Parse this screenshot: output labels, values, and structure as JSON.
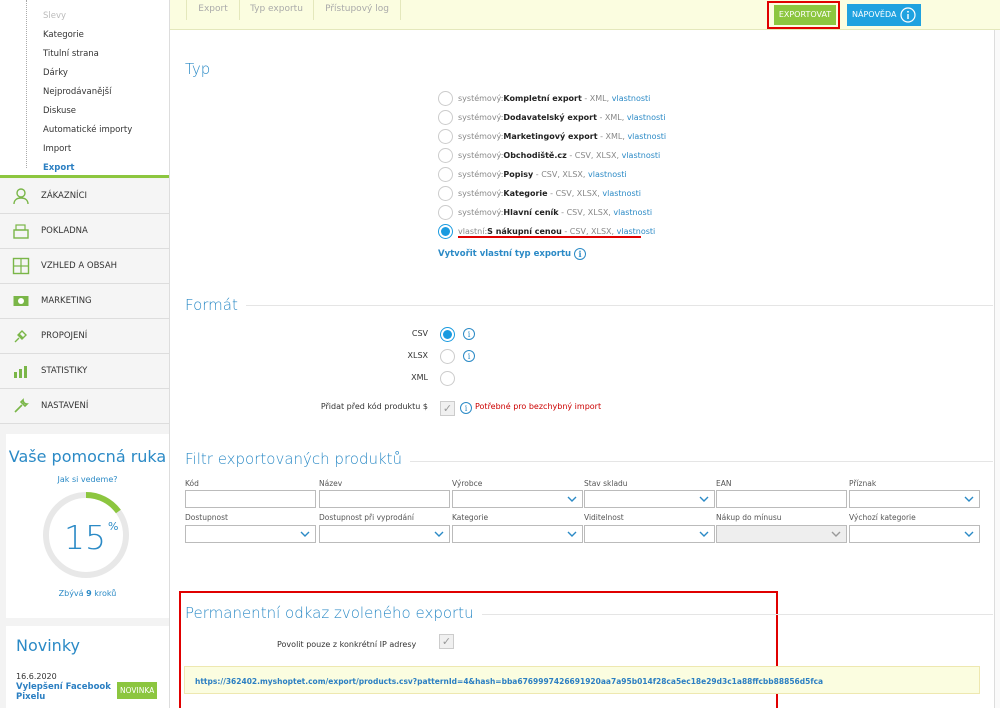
{
  "sidebar": {
    "submenu": [
      {
        "label": "Slevy",
        "state": "faded"
      },
      {
        "label": "Kategorie",
        "state": "normal"
      },
      {
        "label": "Titulní strana",
        "state": "normal"
      },
      {
        "label": "Dárky",
        "state": "normal"
      },
      {
        "label": "Nejprodávanější",
        "state": "normal"
      },
      {
        "label": "Diskuse",
        "state": "normal"
      },
      {
        "label": "Automatické importy",
        "state": "normal"
      },
      {
        "label": "Import",
        "state": "normal"
      },
      {
        "label": "Export",
        "state": "active"
      }
    ],
    "menu": [
      {
        "label": "ZÁKAZNÍCI",
        "icon": "customers-icon"
      },
      {
        "label": "POKLADNA",
        "icon": "cash-register-icon"
      },
      {
        "label": "VZHLED A OBSAH",
        "icon": "layout-icon"
      },
      {
        "label": "MARKETING",
        "icon": "marketing-icon"
      },
      {
        "label": "PROPOJENÍ",
        "icon": "plug-icon"
      },
      {
        "label": "STATISTIKY",
        "icon": "statistics-icon"
      },
      {
        "label": "NASTAVENÍ",
        "icon": "wrench-icon"
      }
    ],
    "help": {
      "title": "Vaše pomocná ruka",
      "link": "Jak si vedeme?",
      "percent": "15",
      "percent_sign": "%",
      "progress": 0.15,
      "steps_prefix": "Zbývá ",
      "steps_count": "9",
      "steps_suffix": " kroků"
    },
    "news": {
      "title": "Novinky",
      "date": "16.6.2020",
      "headline": "Vylepšení Facebook Pixelu",
      "badge": "NOVINKA"
    }
  },
  "topbar": {
    "tabs": [
      "Export",
      "Typ exportu",
      "Přístupový log"
    ],
    "export_button": "EXPORTOVAT",
    "help_button": "NÁPOVĚDA"
  },
  "type_section": {
    "title": "Typ",
    "options": [
      {
        "prefix": "systémový:",
        "name": "Kompletní export",
        "formats": " - XML, ",
        "link": "vlastnosti",
        "checked": false
      },
      {
        "prefix": "systémový:",
        "name": "Dodavatelský export",
        "formats": " - XML, ",
        "link": "vlastnosti",
        "checked": false
      },
      {
        "prefix": "systémový:",
        "name": "Marketingový export",
        "formats": " - XML, ",
        "link": "vlastnosti",
        "checked": false
      },
      {
        "prefix": "systémový:",
        "name": "Obchodiště.cz",
        "formats": " - CSV, XLSX, ",
        "link": "vlastnosti",
        "checked": false
      },
      {
        "prefix": "systémový:",
        "name": "Popisy",
        "formats": " - CSV, XLSX, ",
        "link": "vlastnosti",
        "checked": false
      },
      {
        "prefix": "systémový:",
        "name": "Kategorie",
        "formats": " - CSV, XLSX, ",
        "link": "vlastnosti",
        "checked": false
      },
      {
        "prefix": "systémový:",
        "name": "Hlavní ceník",
        "formats": " - CSV, XLSX, ",
        "link": "vlastnosti",
        "checked": false
      },
      {
        "prefix": "vlastní:",
        "name": "S nákupní cenou",
        "formats": " - CSV, XLSX, ",
        "link": "vlastnosti",
        "checked": true
      }
    ],
    "create_link": "Vytvořit vlastní typ exportu"
  },
  "format_section": {
    "title": "Formát",
    "formats": [
      {
        "label": "CSV",
        "checked": true
      },
      {
        "label": "XLSX",
        "checked": false
      },
      {
        "label": "XML",
        "checked": false
      }
    ],
    "prefix_label": "Přidat před kód produktu $",
    "warning": "Potřebné pro bezchybný import"
  },
  "filter_section": {
    "title": "Filtr exportovaných produktů",
    "row1": [
      {
        "label": "Kód",
        "select": false,
        "disabled": false
      },
      {
        "label": "Název",
        "select": false,
        "disabled": false
      },
      {
        "label": "Výrobce",
        "select": true,
        "disabled": false
      },
      {
        "label": "Stav skladu",
        "select": true,
        "disabled": false
      },
      {
        "label": "EAN",
        "select": false,
        "disabled": false
      },
      {
        "label": "Příznak",
        "select": true,
        "disabled": false
      }
    ],
    "row2": [
      {
        "label": "Dostupnost",
        "select": true,
        "disabled": false
      },
      {
        "label": "Dostupnost při vyprodání",
        "select": true,
        "disabled": false
      },
      {
        "label": "Kategorie",
        "select": true,
        "disabled": false
      },
      {
        "label": "Viditelnost",
        "select": true,
        "disabled": false
      },
      {
        "label": "Nákup do mínusu",
        "select": true,
        "disabled": true
      },
      {
        "label": "Výchozí kategorie",
        "select": true,
        "disabled": false
      }
    ]
  },
  "permanent_section": {
    "title": "Permanentní odkaz zvoleného exportu",
    "ip_label": "Povolit pouze z konkrétní IP adresy",
    "url": "https://362402.myshoptet.com/export/products.csv?patternId=4&hash=bba6769997426691920aa7a95b014f28ca5ec18e29d3c1a88ffcbb88856d5fca"
  },
  "colors": {
    "accent_green": "#8cc63f",
    "accent_blue": "#2b8ac6",
    "highlight_red": "#e00000"
  }
}
